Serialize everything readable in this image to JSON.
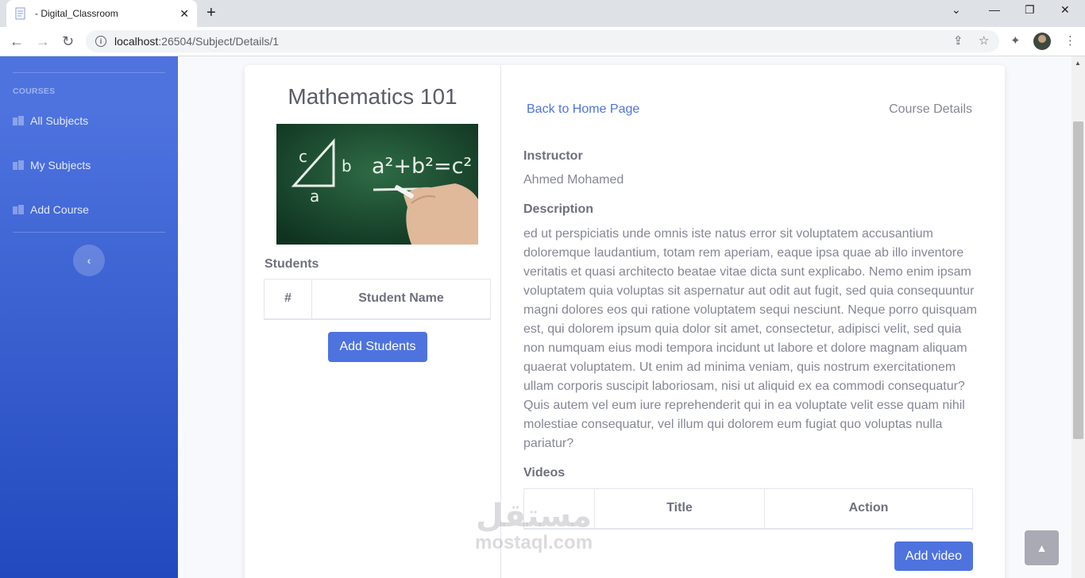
{
  "browser": {
    "tab_title": "- Digital_Classroom",
    "url_host": "localhost",
    "url_path": ":26504/Subject/Details/1"
  },
  "sidebar": {
    "heading": "COURSES",
    "items": [
      {
        "label": "All Subjects"
      },
      {
        "label": "My Subjects"
      },
      {
        "label": "Add Course"
      }
    ]
  },
  "course": {
    "title": "Mathematics 101",
    "students_label": "Students",
    "students_columns": [
      "#",
      "Student Name"
    ],
    "add_students_label": "Add Students"
  },
  "details": {
    "back_link": "Back to Home Page",
    "section_title": "Course Details",
    "instructor_label": "Instructor",
    "instructor_name": "Ahmed Mohamed",
    "description_label": "Description",
    "description": "ed ut perspiciatis unde omnis iste natus error sit voluptatem accusantium doloremque laudantium, totam rem aperiam, eaque ipsa quae ab illo inventore veritatis et quasi architecto beatae vitae dicta sunt explicabo. Nemo enim ipsam voluptatem quia voluptas sit aspernatur aut odit aut fugit, sed quia consequuntur magni dolores eos qui ratione voluptatem sequi nesciunt. Neque porro quisquam est, qui dolorem ipsum quia dolor sit amet, consectetur, adipisci velit, sed quia non numquam eius modi tempora incidunt ut labore et dolore magnam aliquam quaerat voluptatem. Ut enim ad minima veniam, quis nostrum exercitationem ullam corporis suscipit laboriosam, nisi ut aliquid ex ea commodi consequatur? Quis autem vel eum iure reprehenderit qui in ea voluptate velit esse quam nihil molestiae consequatur, vel illum qui dolorem eum fugiat quo voluptas nulla pariatur?",
    "videos_label": "Videos",
    "videos_columns": [
      "",
      "Title",
      "Action"
    ],
    "add_video_label": "Add video"
  },
  "image_text": {
    "triangle_c": "c",
    "triangle_b": "b",
    "triangle_a": "a",
    "formula": "a²+b²=c²"
  },
  "watermark": {
    "arabic": "مستقل",
    "latin": "mostaql.com"
  },
  "icons": {
    "back": "back-arrow-icon",
    "forward": "forward-arrow-icon",
    "reload": "reload-icon",
    "share": "share-icon",
    "bookmark": "star-icon",
    "extensions": "puzzle-icon",
    "menu": "kebab-menu-icon",
    "sidebar_toggle": "chevron-left-icon",
    "scroll_top": "chevron-up-icon"
  },
  "colors": {
    "primary": "#4e73df",
    "sidebar_top": "#4e73df",
    "sidebar_bottom": "#224abe",
    "text": "#858796"
  }
}
